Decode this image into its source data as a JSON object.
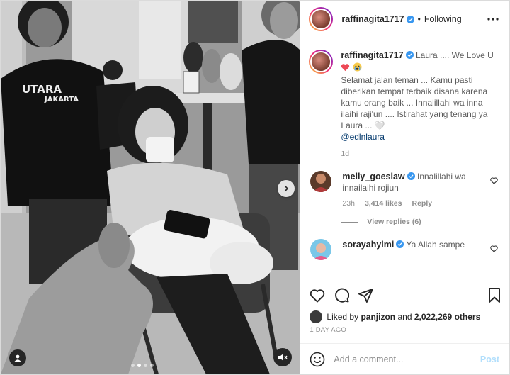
{
  "header": {
    "username": "raffinagita1717",
    "separator": "•",
    "follow_state": "Following"
  },
  "caption": {
    "username": "raffinagita1717",
    "headline": "Laura .... We Love U",
    "body": "Selamat jalan teman ... Kamu pasti diberikan tempat terbaik disana karena kamu orang baik ... Innalillahi wa inna ilaihi raji'un .... Istirahat yang tenang ya Laura ... 🤍",
    "mention": "@edlnlaura",
    "time": "1d"
  },
  "comments": [
    {
      "username": "melly_goeslaw",
      "text": "Innalillahi wa innailaihi rojiun",
      "time": "23h",
      "likes": "3,414 likes",
      "reply_label": "Reply",
      "view_replies": "View replies (6)"
    },
    {
      "username": "sorayahylmi",
      "text": "Ya Allah sampe"
    }
  ],
  "likes": {
    "prefix": "Liked by",
    "user": "panjizon",
    "and": "and",
    "others": "2,022,269 others"
  },
  "date": "1 DAY AGO",
  "add_comment": {
    "placeholder": "Add a comment...",
    "post_label": "Post"
  },
  "photo_text": {
    "shirt_line1": "UTARA",
    "shirt_line2": "JAKARTA"
  },
  "colors": {
    "verified": "#3897f0",
    "red_heart": "#ed4956",
    "link": "#00376b",
    "post_button": "#b2dffc"
  },
  "media": {
    "slide_index": 2,
    "slide_count": 4
  }
}
